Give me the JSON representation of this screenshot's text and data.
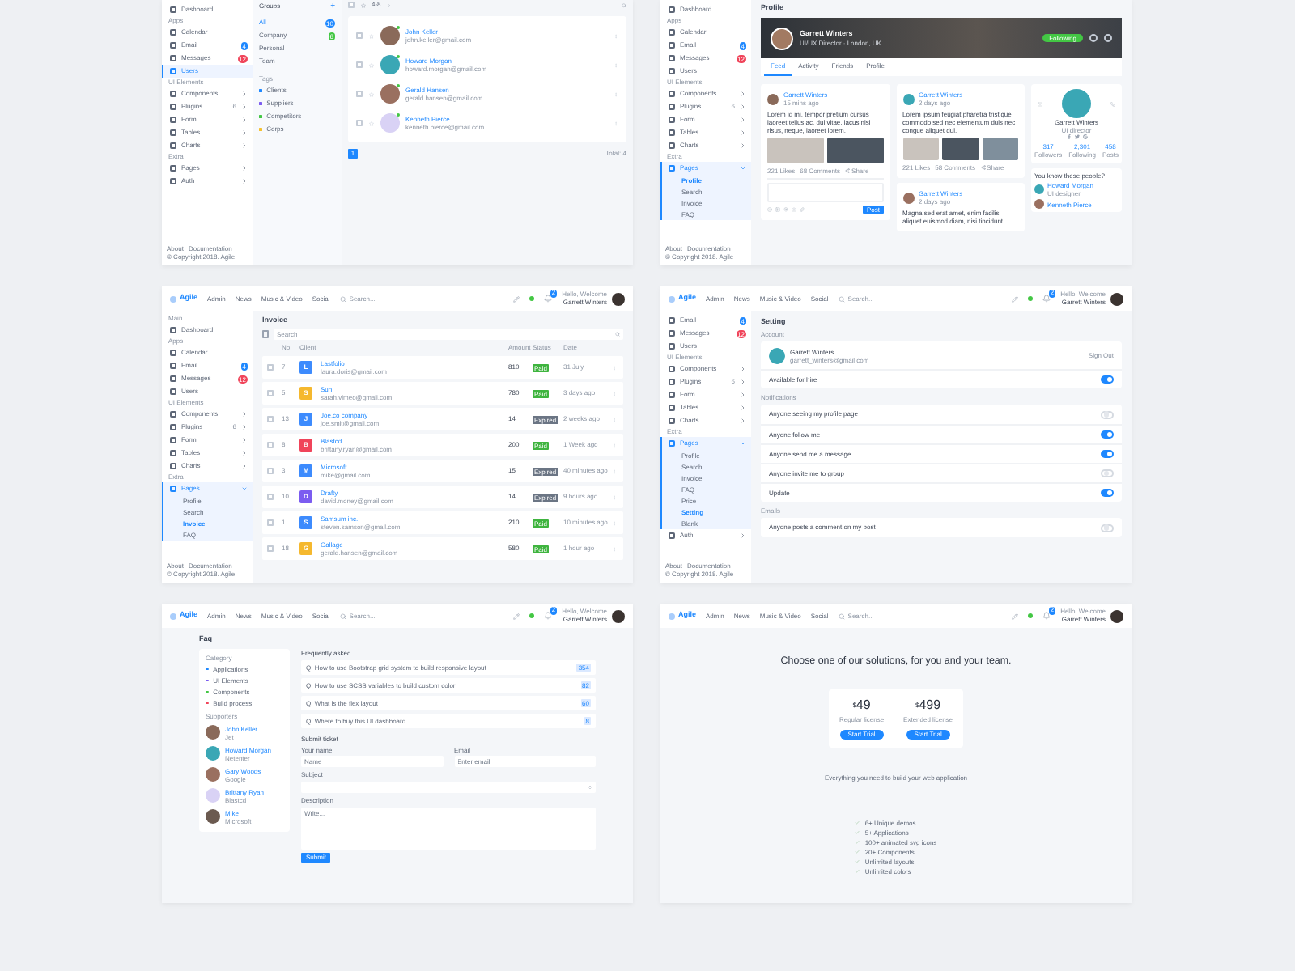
{
  "users_screen": {
    "sidebar": {
      "sections": [
        {
          "items": [
            {
              "label": "Dashboard",
              "selected": false,
              "expandable": false
            }
          ]
        },
        {
          "title": "Apps",
          "items": [
            {
              "label": "Calendar",
              "selected": false,
              "expandable": false
            },
            {
              "label": "Email",
              "selected": false,
              "expandable": false,
              "badge": "4",
              "color": "#1e88ff"
            },
            {
              "label": "Messages",
              "selected": false,
              "expandable": false,
              "badge": "12",
              "color": "#f0445a"
            },
            {
              "label": "Users",
              "selected": true,
              "expandable": false
            }
          ]
        },
        {
          "title": "UI Elements",
          "items": [
            {
              "label": "Components",
              "selected": false,
              "expandable": true
            },
            {
              "label": "Plugins",
              "selected": false,
              "expandable": true,
              "count": "6"
            },
            {
              "label": "Form",
              "selected": false,
              "expandable": true
            },
            {
              "label": "Tables",
              "selected": false,
              "expandable": true
            },
            {
              "label": "Charts",
              "selected": false,
              "expandable": true
            }
          ]
        },
        {
          "title": "Extra",
          "items": [
            {
              "label": "Pages",
              "selected": false,
              "expandable": true
            },
            {
              "label": "Auth",
              "selected": false,
              "expandable": true
            }
          ]
        }
      ],
      "footer_links": [
        "About",
        "Documentation"
      ],
      "copyright": "© Copyright 2018. Agile"
    },
    "groups": {
      "title": "Groups",
      "add": "+",
      "items": [
        {
          "label": "All",
          "selected": true,
          "badge": "10",
          "color": "#1e88ff"
        },
        {
          "label": "Company",
          "selected": false,
          "badge": "6",
          "color": "#43c744"
        },
        {
          "label": "Personal",
          "selected": false
        },
        {
          "label": "Team",
          "selected": false
        }
      ],
      "tags_title": "Tags",
      "tags": [
        {
          "label": "Clients",
          "color": "#1e88ff"
        },
        {
          "label": "Suppliers",
          "color": "#7b5cf0"
        },
        {
          "label": "Competitors",
          "color": "#43c744"
        },
        {
          "label": "Corps",
          "color": "#f5c12e"
        }
      ]
    },
    "toolbar": {
      "checked": false,
      "range": "4-8"
    },
    "contacts": [
      {
        "checked": false,
        "starred": false,
        "name": "John Keller",
        "email": "john.keller@gmail.com",
        "online": true
      },
      {
        "checked": false,
        "starred": false,
        "name": "Howard Morgan",
        "email": "howard.morgan@gmail.com",
        "online": true
      },
      {
        "checked": false,
        "starred": false,
        "name": "Gerald Hansen",
        "email": "gerald.hansen@gmail.com",
        "online": true
      },
      {
        "checked": false,
        "starred": false,
        "name": "Kenneth Pierce",
        "email": "kenneth.pierce@gmail.com",
        "online": true
      }
    ],
    "pages": [
      {
        "label": "1",
        "selected": true
      }
    ],
    "total": "Total: 4"
  },
  "profile_screen": {
    "sidebar": {
      "sections": [
        {
          "items": [
            {
              "label": "Dashboard",
              "selected": false,
              "expandable": false
            }
          ]
        },
        {
          "title": "Apps",
          "items": [
            {
              "label": "Calendar",
              "selected": false,
              "expandable": false
            },
            {
              "label": "Email",
              "selected": false,
              "expandable": false,
              "badge": "4",
              "color": "#1e88ff"
            },
            {
              "label": "Messages",
              "selected": false,
              "expandable": false,
              "badge": "12",
              "color": "#f0445a"
            },
            {
              "label": "Users",
              "selected": false,
              "expandable": false
            }
          ]
        },
        {
          "title": "UI Elements",
          "items": [
            {
              "label": "Components",
              "selected": false,
              "expandable": true
            },
            {
              "label": "Plugins",
              "selected": false,
              "expandable": true,
              "count": "6"
            },
            {
              "label": "Form",
              "selected": false,
              "expandable": true
            },
            {
              "label": "Tables",
              "selected": false,
              "expandable": true
            },
            {
              "label": "Charts",
              "selected": false,
              "expandable": true
            }
          ]
        },
        {
          "title": "Extra",
          "items": [
            {
              "label": "Pages",
              "selected": true,
              "expandable": true,
              "expanded": true,
              "children": [
                {
                  "label": "Profile",
                  "selected": true
                },
                {
                  "label": "Search",
                  "selected": false
                },
                {
                  "label": "Invoice",
                  "selected": false
                },
                {
                  "label": "FAQ",
                  "selected": false
                }
              ]
            }
          ]
        }
      ],
      "footer_links": [
        "About",
        "Documentation"
      ],
      "copyright": "© Copyright 2018. Agile"
    },
    "title": "Profile",
    "cover": {
      "name": "Garrett Winters",
      "subtitle": "UI/UX Director · London, UK",
      "follow_button": "Following"
    },
    "tabs": [
      {
        "label": "Feed",
        "selected": true
      },
      {
        "label": "Activity",
        "selected": false
      },
      {
        "label": "Friends",
        "selected": false
      },
      {
        "label": "Profile",
        "selected": false
      }
    ],
    "posts": [
      {
        "kind": "two_photos",
        "author": "Garrett Winters",
        "time": "15 mins ago",
        "text": "Lorem id mi, tempor pretium cursus laoreet tellus ac, dui vitae, lacus nisl risus, neque, laoreet lorem.",
        "likes": "221 Likes",
        "comments": "68 Comments",
        "share": "Share",
        "reply_button": "Post"
      },
      {
        "kind": "three_photos",
        "author": "Garrett Winters",
        "time": "2 days ago",
        "text": "Lorem ipsum feugiat pharetra tristique commodo sed nec elementum duis nec congue aliquet dui.",
        "likes": "221 Likes",
        "comments": "58 Comments",
        "share": "Share"
      },
      {
        "kind": "text",
        "author": "Garrett Winters",
        "time": "2 days ago",
        "text": "Magna sed erat amet, enim facilisi aliquet euismod diam, nisi tincidunt."
      }
    ],
    "card": {
      "name": "Garrett Winters",
      "role": "UI director",
      "stats": [
        {
          "value": "317",
          "label": "Followers"
        },
        {
          "value": "2,301",
          "label": "Following"
        },
        {
          "value": "458",
          "label": "Posts"
        }
      ]
    },
    "people": {
      "title": "You know these people?",
      "items": [
        {
          "name": "Howard Morgan",
          "note": "UI designer"
        },
        {
          "name": "Kenneth Pierce"
        }
      ]
    }
  },
  "invoice_screen": {
    "topbar": {
      "logo": "Agile",
      "nav": [
        "Admin",
        "News",
        "Music & Video",
        "Social"
      ],
      "search_placeholder": "Search...",
      "badge": "2",
      "greeting": "Hello, Welcome",
      "user": "Garrett Winters"
    },
    "sidebar": {
      "sections": [
        {
          "title": "Main",
          "items": [
            {
              "label": "Dashboard",
              "selected": false,
              "expandable": false
            }
          ]
        },
        {
          "title": "Apps",
          "items": [
            {
              "label": "Calendar",
              "selected": false,
              "expandable": false
            },
            {
              "label": "Email",
              "selected": false,
              "expandable": false,
              "badge": "4",
              "color": "#1e88ff"
            },
            {
              "label": "Messages",
              "selected": false,
              "expandable": false,
              "badge": "12",
              "color": "#f0445a"
            },
            {
              "label": "Users",
              "selected": false,
              "expandable": false
            }
          ]
        },
        {
          "title": "UI Elements",
          "items": [
            {
              "label": "Components",
              "selected": false,
              "expandable": true
            },
            {
              "label": "Plugins",
              "selected": false,
              "expandable": true,
              "count": "6"
            },
            {
              "label": "Form",
              "selected": false,
              "expandable": true
            },
            {
              "label": "Tables",
              "selected": false,
              "expandable": true
            },
            {
              "label": "Charts",
              "selected": false,
              "expandable": true
            }
          ]
        },
        {
          "title": "Extra",
          "items": [
            {
              "label": "Pages",
              "selected": true,
              "expandable": true,
              "expanded": true,
              "children": [
                {
                  "label": "Profile",
                  "selected": false
                },
                {
                  "label": "Search",
                  "selected": false
                },
                {
                  "label": "Invoice",
                  "selected": true
                },
                {
                  "label": "FAQ",
                  "selected": false
                }
              ]
            }
          ]
        }
      ],
      "footer_links": [
        "About",
        "Documentation"
      ],
      "copyright": "© Copyright 2018. Agile"
    },
    "title": "Invoice",
    "search_placeholder": "Search",
    "columns": [
      "No.",
      "Client",
      "Amount",
      "Status",
      "Date"
    ],
    "rows": [
      {
        "checked": false,
        "no": "7",
        "initial": "L",
        "color": "#3d8bfd",
        "client": "Lastfolio",
        "email": "laura.doris@gmail.com",
        "amount": "810",
        "kind": "paid",
        "status": "Paid",
        "date": "31 July"
      },
      {
        "checked": false,
        "no": "5",
        "initial": "S",
        "color": "#f5b82e",
        "client": "Sun",
        "email": "sarah.vimeo@gmail.com",
        "amount": "780",
        "kind": "paid",
        "status": "Paid",
        "date": "3 days ago"
      },
      {
        "checked": false,
        "no": "13",
        "initial": "J",
        "color": "#3d8bfd",
        "client": "Joe.co company",
        "email": "joe.smit@gmail.com",
        "amount": "14",
        "kind": "expired",
        "status": "Expired",
        "date": "2 weeks ago"
      },
      {
        "checked": false,
        "no": "8",
        "initial": "B",
        "color": "#f0445a",
        "client": "Blastcd",
        "email": "brittany.ryan@gmail.com",
        "amount": "200",
        "kind": "paid",
        "status": "Paid",
        "date": "1 Week ago"
      },
      {
        "checked": false,
        "no": "3",
        "initial": "M",
        "color": "#3d8bfd",
        "client": "Microsoft",
        "email": "mike@gmail.com",
        "amount": "15",
        "kind": "expired",
        "status": "Expired",
        "date": "40 minutes ago"
      },
      {
        "checked": false,
        "no": "10",
        "initial": "D",
        "color": "#7b5cf0",
        "client": "Drafty",
        "email": "david.money@gmail.com",
        "amount": "14",
        "kind": "expired",
        "status": "Expired",
        "date": "9 hours ago"
      },
      {
        "checked": false,
        "no": "1",
        "initial": "S",
        "color": "#3d8bfd",
        "client": "Samsum inc.",
        "email": "steven.samson@gmail.com",
        "amount": "210",
        "kind": "paid",
        "status": "Paid",
        "date": "10 minutes ago"
      },
      {
        "checked": false,
        "no": "18",
        "initial": "G",
        "color": "#f5b82e",
        "client": "Gallage",
        "email": "gerald.hansen@gmail.com",
        "amount": "580",
        "kind": "paid",
        "status": "Paid",
        "date": "1 hour ago"
      }
    ]
  },
  "setting_screen": {
    "topbar": {
      "logo": "Agile",
      "nav": [
        "Admin",
        "News",
        "Music & Video",
        "Social"
      ],
      "search_placeholder": "Search...",
      "badge": "2",
      "greeting": "Hello, Welcome",
      "user": "Garrett Winters"
    },
    "sidebar": {
      "sections": [
        {
          "items": [
            {
              "label": "Email",
              "selected": false,
              "expandable": false,
              "badge": "4",
              "color": "#1e88ff"
            },
            {
              "label": "Messages",
              "selected": false,
              "expandable": false,
              "badge": "12",
              "color": "#f0445a"
            },
            {
              "label": "Users",
              "selected": false,
              "expandable": false
            }
          ]
        },
        {
          "title": "UI Elements",
          "items": [
            {
              "label": "Components",
              "selected": false,
              "expandable": true
            },
            {
              "label": "Plugins",
              "selected": false,
              "expandable": true,
              "count": "6"
            },
            {
              "label": "Form",
              "selected": false,
              "expandable": true
            },
            {
              "label": "Tables",
              "selected": false,
              "expandable": true
            },
            {
              "label": "Charts",
              "selected": false,
              "expandable": true
            }
          ]
        },
        {
          "title": "Extra",
          "items": [
            {
              "label": "Pages",
              "selected": true,
              "expandable": true,
              "expanded": true,
              "children": [
                {
                  "label": "Profile",
                  "selected": false
                },
                {
                  "label": "Search",
                  "selected": false
                },
                {
                  "label": "Invoice",
                  "selected": false
                },
                {
                  "label": "FAQ",
                  "selected": false
                },
                {
                  "label": "Price",
                  "selected": false
                },
                {
                  "label": "Setting",
                  "selected": true
                },
                {
                  "label": "Blank",
                  "selected": false
                }
              ]
            },
            {
              "label": "Auth",
              "selected": false,
              "expandable": true
            }
          ]
        }
      ],
      "footer_links": [
        "About",
        "Documentation"
      ],
      "copyright": "© Copyright 2018. Agile"
    },
    "title": "Setting",
    "account": {
      "title": "Account",
      "name": "Garrett Winters",
      "email": "garrett_winters@gmail.com",
      "sign_out": "Sign Out",
      "rows": [
        {
          "label": "Available for hire",
          "on": true
        }
      ]
    },
    "groups": [
      {
        "title": "Notifications",
        "rows": [
          {
            "label": "Anyone seeing my profile page",
            "on": false
          },
          {
            "label": "Anyone follow me",
            "on": true
          },
          {
            "label": "Anyone send me a message",
            "on": true
          },
          {
            "label": "Anyone invite me to group",
            "on": false
          },
          {
            "label": "Update",
            "on": true
          }
        ]
      },
      {
        "title": "Emails",
        "rows": [
          {
            "label": "Anyone posts a comment on my post",
            "on": false
          }
        ]
      }
    ]
  },
  "faq_screen": {
    "topbar": {
      "logo": "Agile",
      "nav": [
        "Admin",
        "News",
        "Music & Video",
        "Social"
      ],
      "search_placeholder": "Search...",
      "badge": "2",
      "greeting": "Hello, Welcome",
      "user": "Garrett Winters"
    },
    "title": "Faq",
    "category_title": "Category",
    "categories": [
      {
        "label": "Applications",
        "color": "#1e88ff"
      },
      {
        "label": "UI Elements",
        "color": "#7b5cf0"
      },
      {
        "label": "Components",
        "color": "#43c744"
      },
      {
        "label": "Build process",
        "color": "#f0445a"
      }
    ],
    "supporters_title": "Supporters",
    "supporters": [
      {
        "name": "John Keller",
        "company": "Jet"
      },
      {
        "name": "Howard Morgan",
        "company": "Netenter"
      },
      {
        "name": "Gary Woods",
        "company": "Google"
      },
      {
        "name": "Brittany Ryan",
        "company": "Blastcd"
      },
      {
        "name": "Mike",
        "company": "Microsoft"
      }
    ],
    "faq_title": "Frequently asked",
    "questions": [
      {
        "text": "Q: How to use Bootstrap grid system to build responsive layout",
        "count": "354"
      },
      {
        "text": "Q: How to use SCSS variables to build custom color",
        "count": "82"
      },
      {
        "text": "Q: What is the flex layout",
        "count": "60"
      },
      {
        "text": "Q: Where to buy this UI dashboard",
        "count": "8"
      }
    ],
    "ticket_title": "Submit ticket",
    "name_label": "Your name",
    "name_placeholder": "Name",
    "email_label": "Email",
    "email_placeholder": "Enter email",
    "subject_label": "Subject",
    "description_label": "Description",
    "description_placeholder": "Write...",
    "submit": "Submit"
  },
  "pricing_screen": {
    "topbar": {
      "logo": "Agile",
      "nav": [
        "Admin",
        "News",
        "Music & Video",
        "Social"
      ],
      "search_placeholder": "Search...",
      "badge": "2",
      "greeting": "Hello, Welcome",
      "user": "Garrett Winters"
    },
    "heading": "Choose one of our solutions, for you and your team.",
    "plans": [
      {
        "currency": "$",
        "price": "49",
        "name": "Regular license",
        "button": "Start Trial"
      },
      {
        "currency": "$",
        "price": "499",
        "name": "Extended license",
        "button": "Start Trial"
      }
    ],
    "tagline": "Everything you need to build your web application",
    "features": [
      "6+ Unique demos",
      "5+ Applications",
      "100+ animated svg icons",
      "20+ Components",
      "Unlimited layouts",
      "Unlimited colors"
    ]
  }
}
